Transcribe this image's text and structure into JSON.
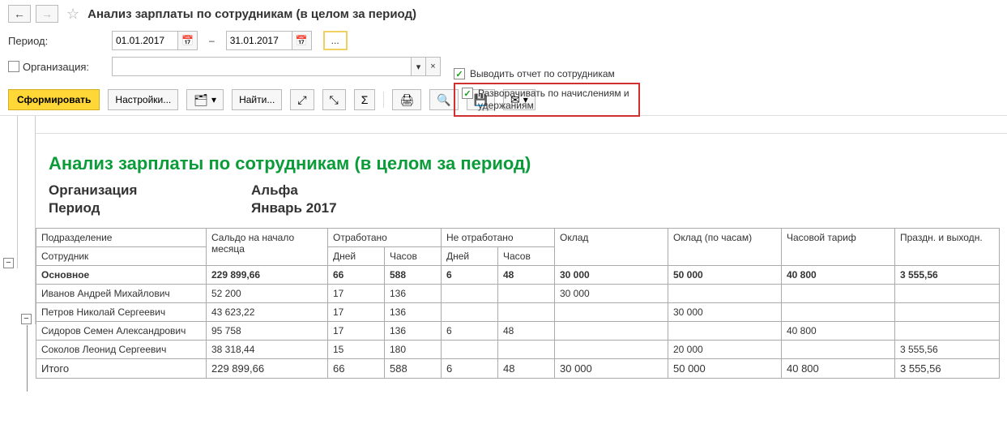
{
  "title": "Анализ зарплаты по сотрудникам (в целом за период)",
  "filters": {
    "period_label": "Период:",
    "date_from": "01.01.2017",
    "date_to": "31.01.2017",
    "ellipsis": "...",
    "org_label": "Организация:",
    "org_value": "",
    "cb_output_label": "Выводить отчет по сотрудникам",
    "cb_expand_label": "Разворачивать по начислениям и удержаниям"
  },
  "toolbar": {
    "generate": "Сформировать",
    "settings": "Настройки...",
    "find": "Найти..."
  },
  "report": {
    "title": "Анализ зарплаты по сотрудникам (в целом за период)",
    "meta": {
      "org_label": "Организация",
      "org_value": "Альфа",
      "period_label": "Период",
      "period_value": "Январь 2017"
    },
    "headers": {
      "division": "Подразделение",
      "employee": "Сотрудник",
      "saldo": "Сальдо на начало месяца",
      "worked": "Отработано",
      "not_worked": "Не отработано",
      "days": "Дней",
      "hours": "Часов",
      "salary": "Оклад",
      "salary_hours": "Оклад (по часам)",
      "hourly_rate": "Часовой тариф",
      "holidays": "Праздн. и выходн."
    },
    "group_name": "Основное",
    "group_totals": {
      "saldo": "229 899,66",
      "w_days": "66",
      "w_hours": "588",
      "nw_days": "6",
      "nw_hours": "48",
      "salary": "30 000",
      "salary_h": "50 000",
      "rate": "40 800",
      "holiday": "3 555,56"
    },
    "rows": [
      {
        "name": "Иванов Андрей Михайлович",
        "saldo": "52 200",
        "w_days": "17",
        "w_hours": "136",
        "nw_days": "",
        "nw_hours": "",
        "salary": "30 000",
        "salary_h": "",
        "rate": "",
        "holiday": ""
      },
      {
        "name": "Петров Николай Сергеевич",
        "saldo": "43 623,22",
        "w_days": "17",
        "w_hours": "136",
        "nw_days": "",
        "nw_hours": "",
        "salary": "",
        "salary_h": "30 000",
        "rate": "",
        "holiday": ""
      },
      {
        "name": "Сидоров Семен Александрович",
        "saldo": "95 758",
        "w_days": "17",
        "w_hours": "136",
        "nw_days": "6",
        "nw_hours": "48",
        "salary": "",
        "salary_h": "",
        "rate": "40 800",
        "holiday": ""
      },
      {
        "name": "Соколов Леонид Сергеевич",
        "saldo": "38 318,44",
        "w_days": "15",
        "w_hours": "180",
        "nw_days": "",
        "nw_hours": "",
        "salary": "",
        "salary_h": "20 000",
        "rate": "",
        "holiday": "3 555,56"
      }
    ],
    "total_label": "Итого",
    "totals": {
      "saldo": "229 899,66",
      "w_days": "66",
      "w_hours": "588",
      "nw_days": "6",
      "nw_hours": "48",
      "salary": "30 000",
      "salary_h": "50 000",
      "rate": "40 800",
      "holiday": "3 555,56"
    }
  }
}
